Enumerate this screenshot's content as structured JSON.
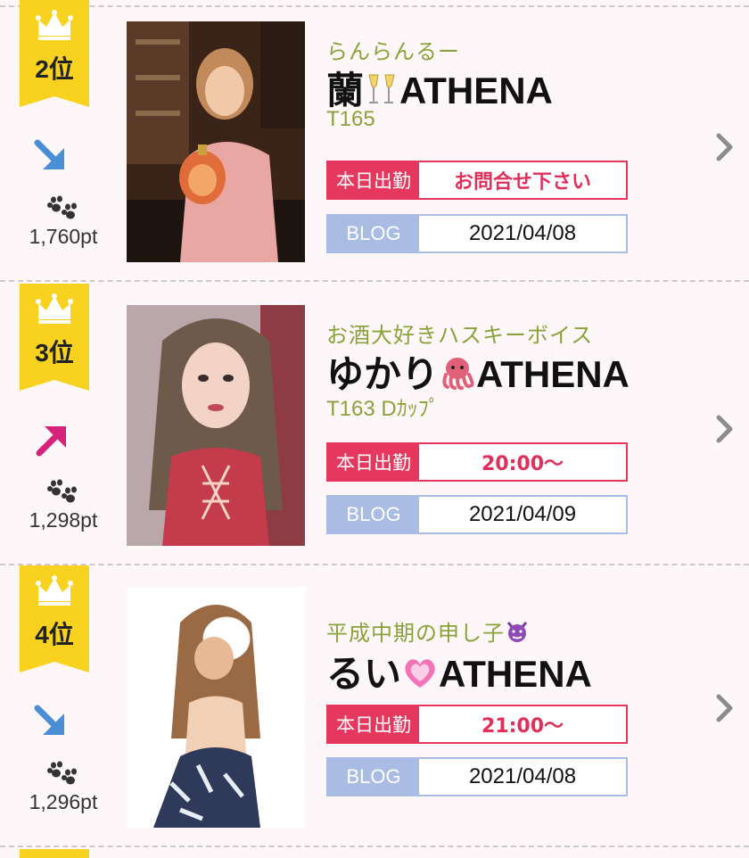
{
  "colors": {
    "accent_pink": "#e6375e",
    "blog_blue": "#a9bde4",
    "catch_green": "#8aa23a",
    "crown_yellow": "#f8d21f",
    "trend_down": "#4a8fd6",
    "trend_up": "#d6237a"
  },
  "entries": [
    {
      "rank": "2位",
      "trend": "down",
      "trend_icon": "arrow-down-right-icon",
      "points": "1,760pt",
      "catch": "らんらんるー",
      "name_prefix": "蘭",
      "name_emoji": "champagne-glasses-icon",
      "name_suffix": "ATHENA",
      "spec": "T165",
      "work_label": "本日出勤",
      "work_value": "お問合せ下さい",
      "blog_label": "BLOG",
      "blog_date": "2021/04/08"
    },
    {
      "rank": "3位",
      "trend": "up",
      "trend_icon": "arrow-up-right-icon",
      "points": "1,298pt",
      "catch": "お酒大好きハスキーボイス",
      "name_prefix": "ゆかり",
      "name_emoji": "octopus-icon",
      "name_suffix": "ATHENA",
      "spec": "T163 Dｶｯﾌﾟ",
      "work_label": "本日出勤",
      "work_value": "20:00～",
      "blog_label": "BLOG",
      "blog_date": "2021/04/09"
    },
    {
      "rank": "4位",
      "trend": "down",
      "trend_icon": "arrow-down-right-icon",
      "points": "1,296pt",
      "catch": "平成中期の申し子",
      "catch_emoji": "smiling-devil-icon",
      "name_prefix": "るい",
      "name_emoji": "growing-heart-icon",
      "name_suffix": "ATHENA",
      "spec": "",
      "work_label": "本日出勤",
      "work_value": "21:00～",
      "blog_label": "BLOG",
      "blog_date": "2021/04/08"
    }
  ]
}
